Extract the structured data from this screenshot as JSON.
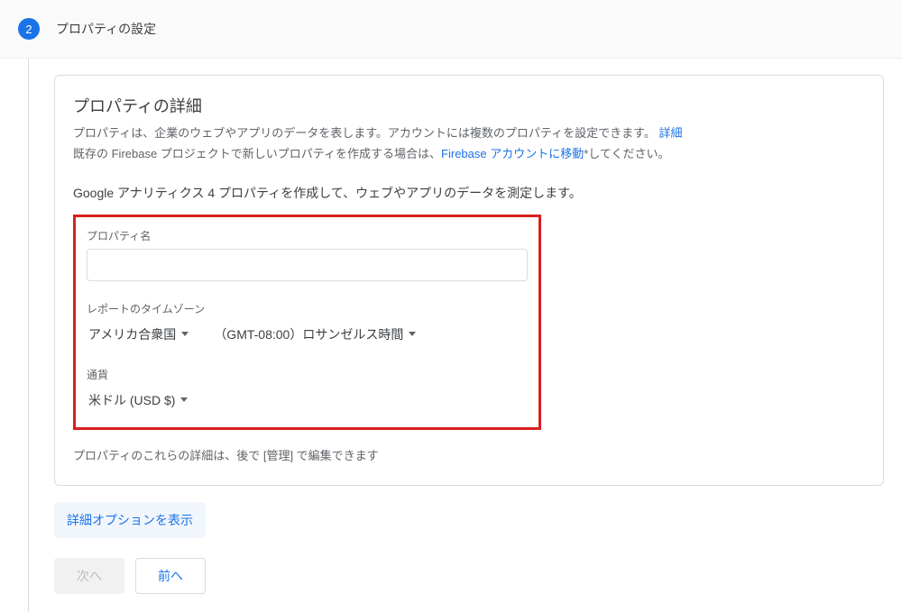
{
  "header": {
    "step_number": "2",
    "title": "プロパティの設定"
  },
  "card": {
    "title": "プロパティの詳細",
    "desc_line1_pre": "プロパティは、企業のウェブやアプリのデータを表します。アカウントには複数のプロパティを設定できます。 ",
    "desc_line1_link": "詳細",
    "desc_line2_pre": "既存の Firebase プロジェクトで新しいプロパティを作成する場合は、",
    "desc_line2_link": "Firebase アカウントに移動",
    "desc_line2_post": "*してください。",
    "section_lead": "Google アナリティクス 4 プロパティを作成して、ウェブやアプリのデータを測定します。",
    "property_name_label": "プロパティ名",
    "property_name_value": "",
    "timezone_label": "レポートのタイムゾーン",
    "timezone_country": "アメリカ合衆国",
    "timezone_value": "（GMT-08:00）ロサンゼルス時間",
    "currency_label": "通貨",
    "currency_value": "米ドル (USD $)",
    "edit_note": "プロパティのこれらの詳細は、後で [管理] で編集できます"
  },
  "advanced_button": "詳細オプションを表示",
  "buttons": {
    "next": "次へ",
    "prev": "前へ"
  }
}
